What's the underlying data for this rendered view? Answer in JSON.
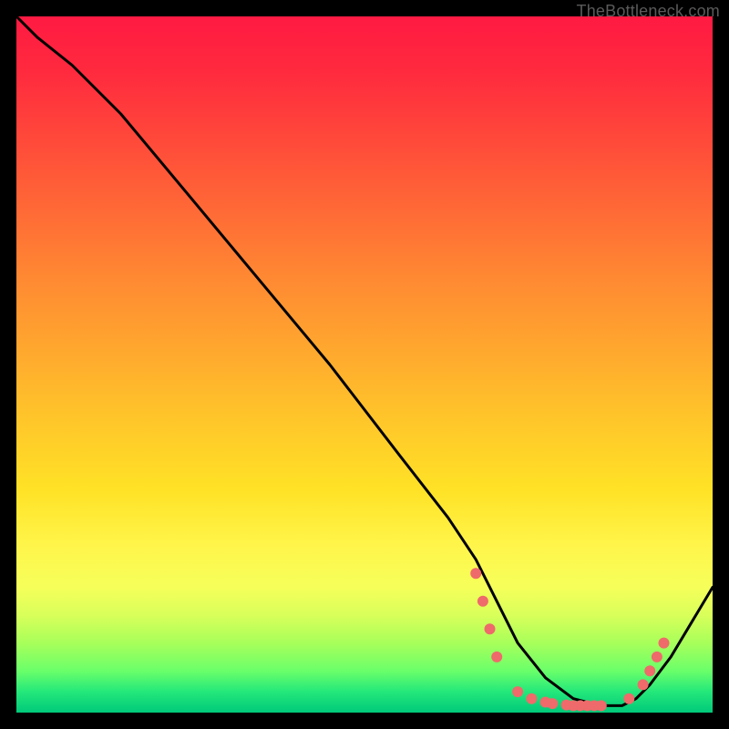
{
  "watermark": "TheBottleneck.com",
  "chart_data": {
    "type": "line",
    "title": "",
    "xlabel": "",
    "ylabel": "",
    "xlim": [
      0,
      100
    ],
    "ylim": [
      0,
      100
    ],
    "grid": false,
    "legend": false,
    "series": [
      {
        "name": "curve",
        "color": "#000000",
        "x": [
          0,
          3,
          8,
          15,
          25,
          35,
          45,
          55,
          62,
          66,
          69,
          72,
          76,
          80,
          84,
          87,
          89,
          91,
          94,
          97,
          100
        ],
        "y": [
          100,
          97,
          93,
          86,
          74,
          62,
          50,
          37,
          28,
          22,
          16,
          10,
          5,
          2,
          1,
          1,
          2,
          4,
          8,
          13,
          18
        ]
      }
    ],
    "markers": {
      "color": "#ef6a6a",
      "radius": 6,
      "points": [
        {
          "x": 66,
          "y": 20
        },
        {
          "x": 67,
          "y": 16
        },
        {
          "x": 68,
          "y": 12
        },
        {
          "x": 69,
          "y": 8
        },
        {
          "x": 72,
          "y": 3
        },
        {
          "x": 74,
          "y": 2
        },
        {
          "x": 76,
          "y": 1.5
        },
        {
          "x": 77,
          "y": 1.3
        },
        {
          "x": 79,
          "y": 1.1
        },
        {
          "x": 80,
          "y": 1
        },
        {
          "x": 81,
          "y": 1
        },
        {
          "x": 82,
          "y": 1
        },
        {
          "x": 83,
          "y": 1
        },
        {
          "x": 84,
          "y": 1
        },
        {
          "x": 88,
          "y": 2
        },
        {
          "x": 90,
          "y": 4
        },
        {
          "x": 91,
          "y": 6
        },
        {
          "x": 92,
          "y": 8
        },
        {
          "x": 93,
          "y": 10
        }
      ]
    }
  }
}
